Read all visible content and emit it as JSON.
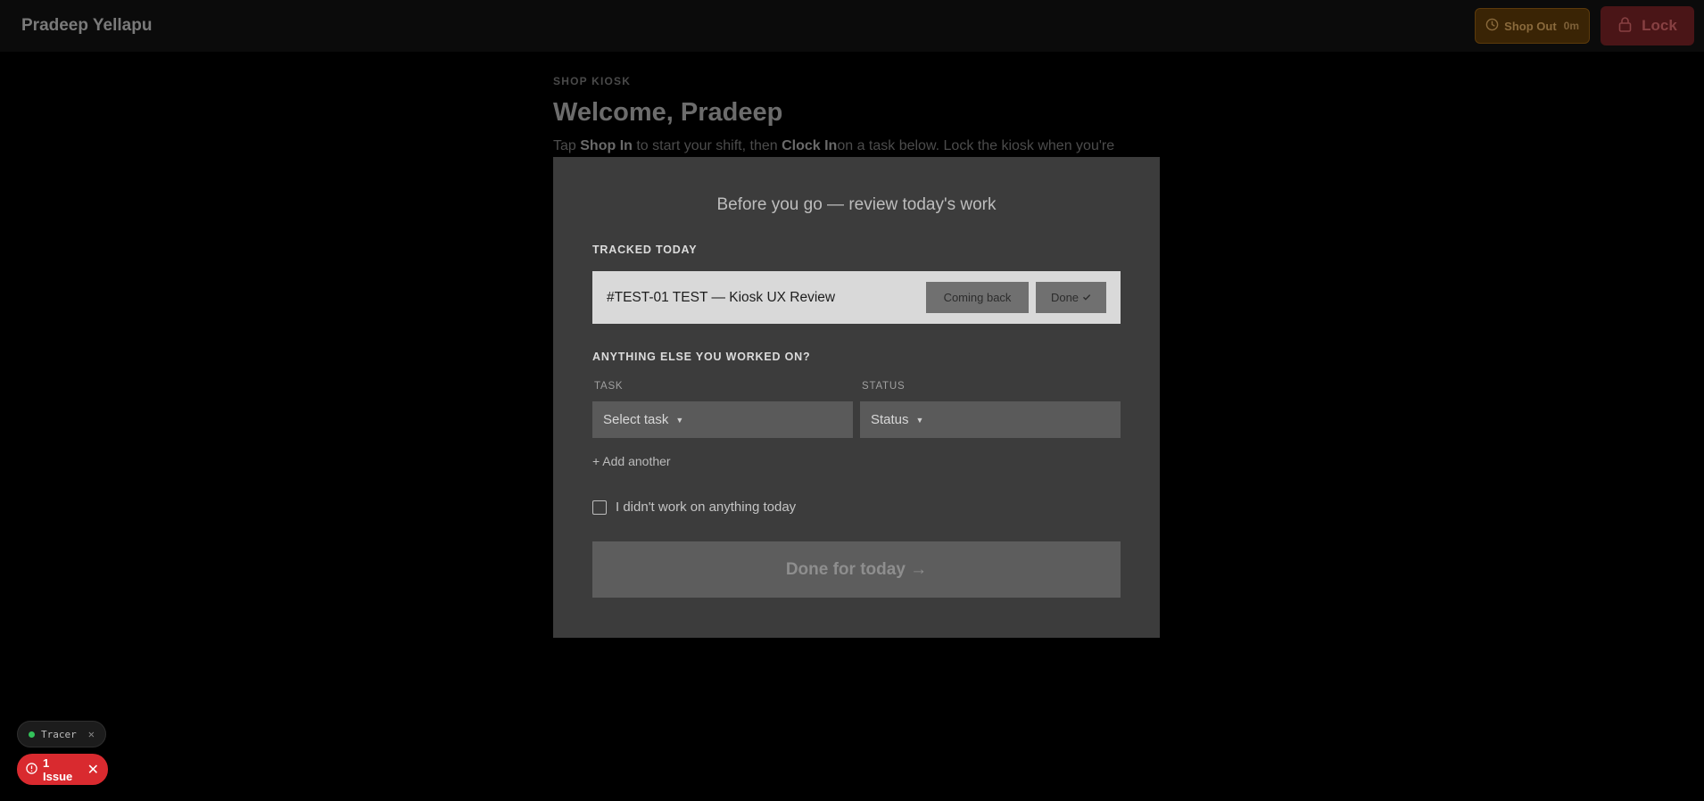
{
  "header": {
    "user_name": "Pradeep Yellapu",
    "shop_out_label": "Shop Out",
    "shop_out_timer": "0m",
    "lock_label": "Lock"
  },
  "page": {
    "eyebrow": "SHOP KIOSK",
    "welcome": "Welcome, Pradeep",
    "instructions": {
      "part1": "Tap ",
      "shop_in": "Shop In",
      "part2": " to start your shift, then ",
      "clock_in": "Clock In",
      "part3": "on a task below. Lock the kiosk when you're"
    }
  },
  "modal": {
    "title": "Before you go — review today's work",
    "tracked_title": "TRACKED TODAY",
    "tracked": [
      {
        "name": "#TEST-01 TEST — Kiosk UX Review",
        "coming_back_label": "Coming back",
        "done_label": "Done"
      }
    ],
    "else_title": "ANYTHING ELSE YOU WORKED ON?",
    "task_label": "TASK",
    "task_placeholder": "Select task",
    "status_label": "STATUS",
    "status_placeholder": "Status",
    "add_another": "+ Add another",
    "no_work_label": "I didn't work on anything today",
    "submit_label": "Done for today →"
  },
  "devtools": {
    "tracer_label": "Tracer",
    "issue_label": "1 Issue"
  },
  "colors": {
    "accent_red": "#d92a2f",
    "tracer_green": "#33c25a",
    "modal_bg": "#3c3c3c"
  }
}
